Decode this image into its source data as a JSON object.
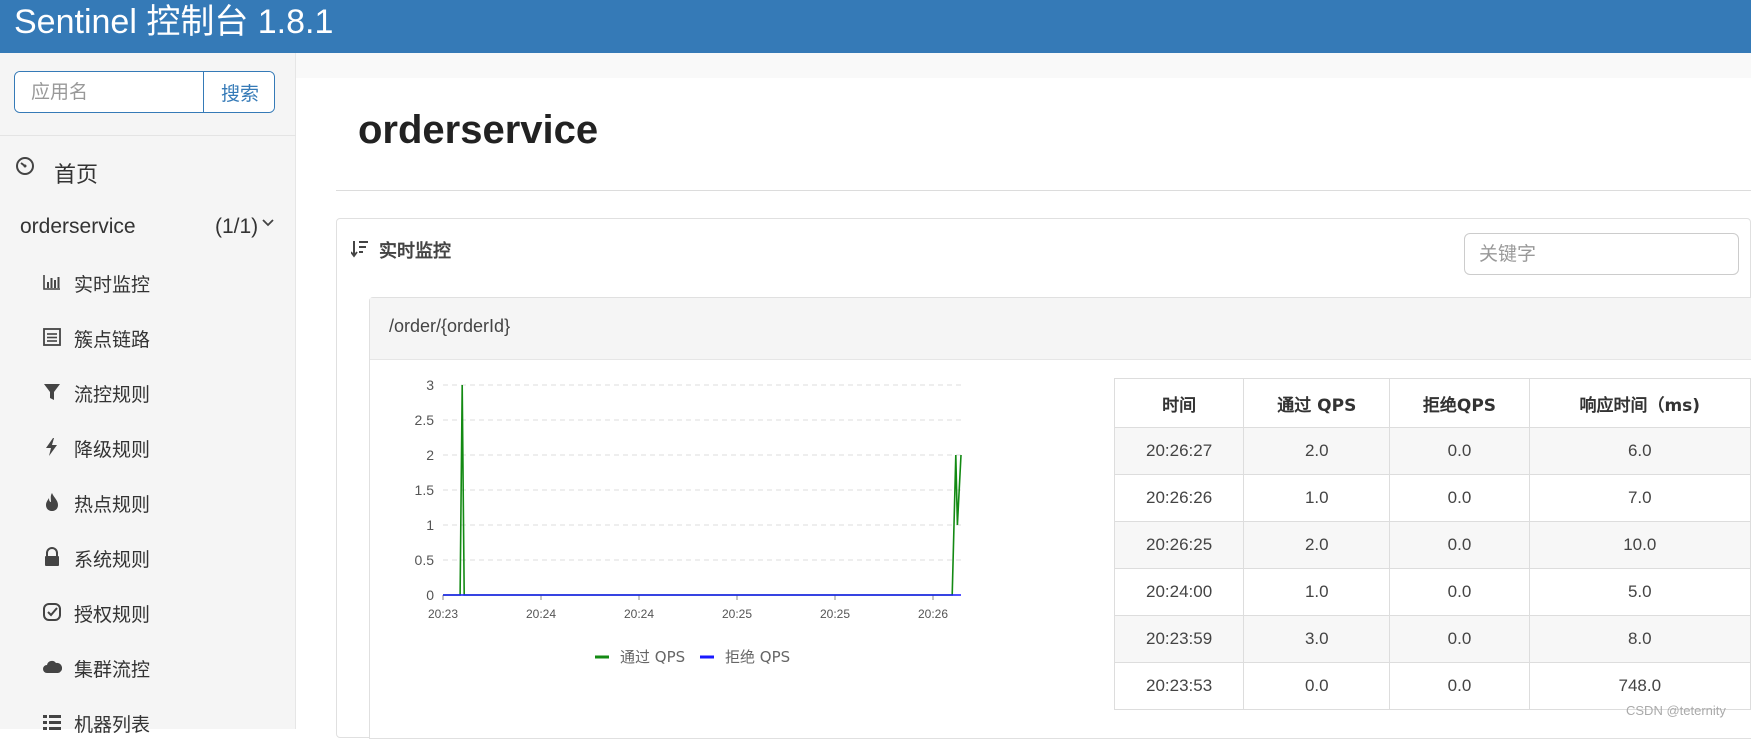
{
  "header": {
    "title": "Sentinel 控制台 1.8.1"
  },
  "sidebar": {
    "search": {
      "placeholder": "应用名",
      "button_label": "搜索"
    },
    "home_label": "首页",
    "app": {
      "name": "orderservice",
      "count": "(1/1)"
    },
    "items": [
      {
        "label": "实时监控",
        "icon": "bar-chart-icon"
      },
      {
        "label": "簇点链路",
        "icon": "list-icon"
      },
      {
        "label": "流控规则",
        "icon": "filter-icon"
      },
      {
        "label": "降级规则",
        "icon": "lightning-icon"
      },
      {
        "label": "热点规则",
        "icon": "fire-icon"
      },
      {
        "label": "系统规则",
        "icon": "lock-icon"
      },
      {
        "label": "授权规则",
        "icon": "check-circle-icon"
      },
      {
        "label": "集群流控",
        "icon": "cloud-icon"
      },
      {
        "label": "机器列表",
        "icon": "list-icon"
      }
    ]
  },
  "main": {
    "page_title": "orderservice",
    "panel": {
      "title": "实时监控",
      "keyword_placeholder": "关键字",
      "resource": "/order/{orderId}"
    }
  },
  "chart_data": {
    "type": "line",
    "x_ticks": [
      "20:23",
      "20:24",
      "20:24",
      "20:25",
      "20:25",
      "20:26"
    ],
    "y_ticks": [
      "0",
      "0.5",
      "1",
      "1.5",
      "2",
      "2.5",
      "3"
    ],
    "ylim": [
      0,
      3
    ],
    "grid": true,
    "legend_position": "bottom",
    "colors": {
      "pass": "#138a13",
      "block": "#1a1aff"
    },
    "series": [
      {
        "name": "通过 QPS",
        "points": [
          [
            0,
            0
          ],
          [
            0.033,
            0
          ],
          [
            0.037,
            3
          ],
          [
            0.041,
            0
          ],
          [
            0.05,
            0
          ],
          [
            0.983,
            0
          ],
          [
            0.99,
            2
          ],
          [
            0.993,
            1
          ],
          [
            1.0,
            2
          ]
        ]
      },
      {
        "name": "拒绝 QPS",
        "points": [
          [
            0,
            0
          ],
          [
            1.0,
            0
          ]
        ]
      }
    ]
  },
  "table": {
    "headers": [
      "时间",
      "通过 QPS",
      "拒绝QPS",
      "响应时间（ms)"
    ],
    "rows": [
      [
        "20:26:27",
        "2.0",
        "0.0",
        "6.0"
      ],
      [
        "20:26:26",
        "1.0",
        "0.0",
        "7.0"
      ],
      [
        "20:26:25",
        "2.0",
        "0.0",
        "10.0"
      ],
      [
        "20:24:00",
        "1.0",
        "0.0",
        "5.0"
      ],
      [
        "20:23:59",
        "3.0",
        "0.0",
        "8.0"
      ],
      [
        "20:23:53",
        "0.0",
        "0.0",
        "748.0"
      ]
    ]
  },
  "watermark": "CSDN @teternity"
}
